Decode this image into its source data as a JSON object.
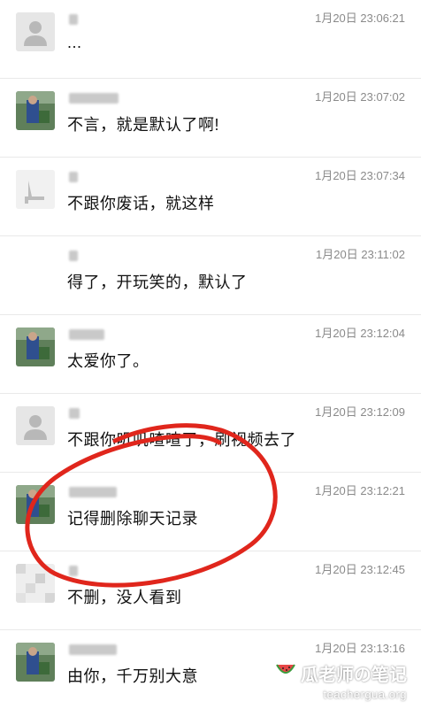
{
  "messages": [
    {
      "time": "1月20日 23:06:21",
      "text": "...",
      "avatar": "default-person-icon"
    },
    {
      "time": "1月20日 23:07:02",
      "text": "不言，就是默认了啊!",
      "avatar": "photo-avatar"
    },
    {
      "time": "1月20日 23:07:34",
      "text": "不跟你废话，就这样",
      "avatar": "chair-avatar"
    },
    {
      "time": "1月20日 23:11:02",
      "text": "得了，开玩笑的，默认了",
      "avatar": "blank-avatar"
    },
    {
      "time": "1月20日 23:12:04",
      "text": "太爱你了。",
      "avatar": "photo-avatar"
    },
    {
      "time": "1月20日 23:12:09",
      "text": "不跟你叽叽喳喳了，刷视频去了",
      "avatar": "default-person-icon"
    },
    {
      "time": "1月20日 23:12:21",
      "text": "记得删除聊天记录",
      "avatar": "photo-avatar"
    },
    {
      "time": "1月20日 23:12:45",
      "text": "不删，没人看到",
      "avatar": "pixelated-avatar"
    },
    {
      "time": "1月20日 23:13:16",
      "text": "由你，千万别大意",
      "avatar": "photo-avatar"
    }
  ],
  "annotation": {
    "color": "#e0261c",
    "shape": "hand-drawn-circle"
  },
  "watermark": {
    "title": "瓜老师の笔记",
    "url": "teachergua.org",
    "icon": "watermelon-icon"
  }
}
